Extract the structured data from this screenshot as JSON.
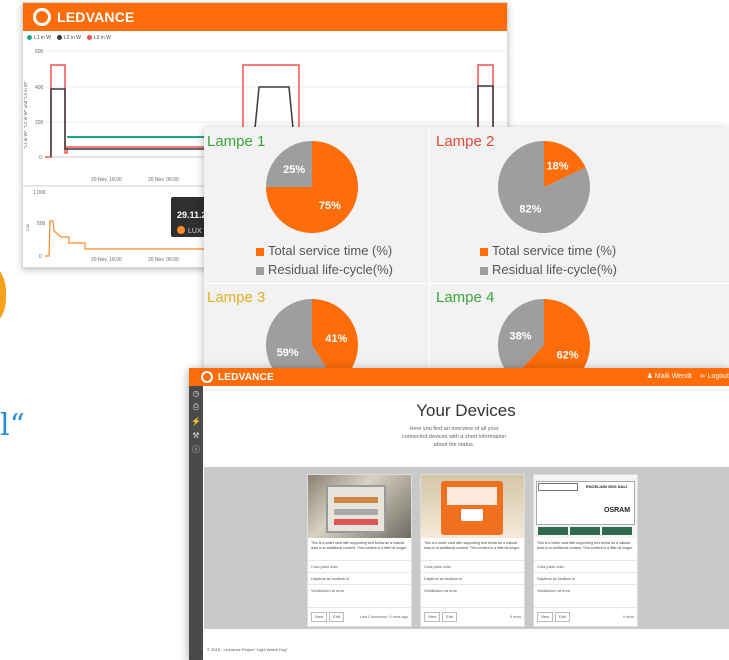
{
  "brand": "LEDVANCE",
  "colors": {
    "orange": "#ff6c0a",
    "teal": "#1aa988",
    "dark": "#3a3a3a",
    "red": "#f0534d",
    "gray": "#9e9e9e"
  },
  "power_chart": {
    "legend": [
      "L1 in W",
      "L2 in W",
      "L3 in W"
    ],
    "yticks": [
      "600",
      "400",
      "200",
      "0"
    ],
    "ylabel": "\"L1 in W\", \"L2 in W\" und \"L3 in W\"",
    "xticks": [
      "20 Nov. 18:00",
      "20 Nov. 06:00"
    ]
  },
  "lux_chart": {
    "yticks": [
      "1.000",
      "500",
      "0"
    ],
    "ylabel": "Lux",
    "xticks": [
      "20 Nov. 18:00",
      "20 Nov. 06:00"
    ],
    "tooltip_value": "29.11.2",
    "tooltip_series": "LUX"
  },
  "pies": [
    {
      "title": "Lampe 1",
      "title_color": "#3aa63a",
      "total": 75,
      "residual": 25,
      "total_label": "75%",
      "residual_label": "25%"
    },
    {
      "title": "Lampe 2",
      "title_color": "#e04b3a",
      "total": 18,
      "residual": 82,
      "total_label": "18%",
      "residual_label": "82%"
    },
    {
      "title": "Lampe 3",
      "title_color": "#e0b020",
      "total": 41,
      "residual": 59,
      "total_label": "41%",
      "residual_label": "59%"
    },
    {
      "title": "Lampe 4",
      "title_color": "#3aa63a",
      "total": 62,
      "residual": 38,
      "total_label": "62%",
      "residual_label": "38%"
    }
  ],
  "pie_legend": {
    "total": "Total service time (%)",
    "residual": "Residual life-cycle(%)"
  },
  "devices_page": {
    "user": "Maik Wendt",
    "logout": "Logout",
    "title": "Your Devices",
    "subtitle": "Here you find an overview of all your connected devices with a short information about the status.",
    "cards": [
      {
        "desc": "This is a wider card with supporting text below as a natural lead-in to additional content. This content is a little bit longer.",
        "lines": [
          "Cras justo odio",
          "Dapibus ac facilisis in",
          "Vestibulum at eros"
        ],
        "view": "View",
        "edit": "Edit",
        "time": "Last Connection: 9 mins ago"
      },
      {
        "desc": "This is a wider card with supporting text below as a natural lead-in to additional content. This content is a little bit longer.",
        "lines": [
          "Cras justo odio",
          "Dapibus ac facilisis in",
          "Vestibulum at eros"
        ],
        "view": "View",
        "edit": "Edit",
        "time": "9 mins"
      },
      {
        "desc": "This is a wider card with supporting text below as a natural lead-in to additional content. This content is a little bit longer.",
        "lines": [
          "Cras justo odio",
          "Dapibus ac facilisis in",
          "Vestibulum at eros"
        ],
        "view": "View",
        "edit": "Edit",
        "time": "9 mins"
      }
    ],
    "device_label": "ENCELIUM GDS DALI",
    "device_brand": "OSRAM",
    "footer": "© 2018 - Ledvance Project \"Light Watch Dog\""
  },
  "side_icons": [
    "clock-icon",
    "printer-icon",
    "bolt-icon",
    "wrench-icon",
    "info-icon"
  ]
}
